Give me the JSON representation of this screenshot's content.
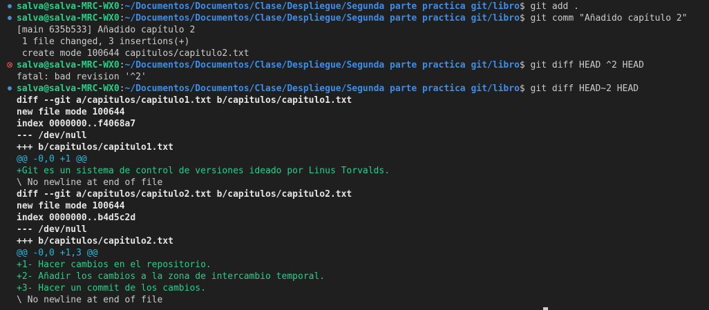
{
  "prompt": {
    "user_host": "salva@salva-MRC-WX0",
    "colon": ":",
    "path": "~/Documentos/Documentos/Clase/Despliegue/Segunda parte practica git/libro",
    "symbol": "$"
  },
  "commands": {
    "c1": " git add .",
    "c2": " git comm \"Añadido capítulo 2\"",
    "c3": " git diff HEAD ^2 HEAD",
    "c4": " git diff HEAD~2 HEAD"
  },
  "output": {
    "commit_head": "[main 635b533] Añadido capítulo 2",
    "commit_stats": " 1 file changed, 3 insertions(+)",
    "commit_create": " create mode 100644 capitulos/capitulo2.txt",
    "fatal": "fatal: bad revision '^2'",
    "diff1_header": "diff --git a/capitulos/capitulo1.txt b/capitulos/capitulo1.txt",
    "diff1_mode": "new file mode 100644",
    "diff1_index": "index 0000000..f4068a7",
    "diff1_minus": "--- /dev/null",
    "diff1_plus": "+++ b/capitulos/capitulo1.txt",
    "diff1_hunk": "@@ -0,0 +1 @@",
    "diff1_add1": "+Git es un sistema de control de versiones ideado por Linus Torvalds.",
    "diff1_nonl": "\\ No newline at end of file",
    "diff2_header": "diff --git a/capitulos/capitulo2.txt b/capitulos/capitulo2.txt",
    "diff2_mode": "new file mode 100644",
    "diff2_index": "index 0000000..b4d5c2d",
    "diff2_minus": "--- /dev/null",
    "diff2_plus": "+++ b/capitulos/capitulo2.txt",
    "diff2_hunk": "@@ -0,0 +1,3 @@",
    "diff2_add1": "+1- Hacer cambios en el repositorio.",
    "diff2_add2": "+2- Añadir los cambios a la zona de intercambio temporal.",
    "diff2_add3": "+3- Hacer un commit de los cambios.",
    "diff2_nonl": "\\ No newline at end of file"
  },
  "colors": {
    "background": "#1f1f1f",
    "prompt_user": "#23d18b",
    "prompt_path": "#3b8eea",
    "hunk": "#29b8db",
    "added": "#23d18b",
    "success_dot": "#4a90c9",
    "error_icon": "#e05252"
  },
  "icons": {
    "success_marker": "circle-dot-icon",
    "error_marker": "error-circle-x-icon"
  }
}
